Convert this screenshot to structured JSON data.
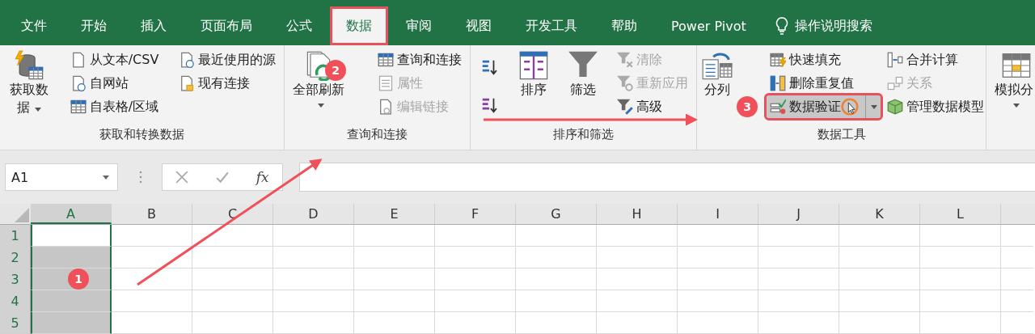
{
  "tabs": [
    {
      "label": "文件",
      "selected": false,
      "highlighted": false
    },
    {
      "label": "开始",
      "selected": false,
      "highlighted": false
    },
    {
      "label": "插入",
      "selected": false,
      "highlighted": false
    },
    {
      "label": "页面布局",
      "selected": false,
      "highlighted": false
    },
    {
      "label": "公式",
      "selected": false,
      "highlighted": false
    },
    {
      "label": "数据",
      "selected": true,
      "highlighted": true
    },
    {
      "label": "审阅",
      "selected": false,
      "highlighted": false
    },
    {
      "label": "视图",
      "selected": false,
      "highlighted": false
    },
    {
      "label": "开发工具",
      "selected": false,
      "highlighted": false
    },
    {
      "label": "帮助",
      "selected": false,
      "highlighted": false
    },
    {
      "label": "Power Pivot",
      "selected": false,
      "highlighted": false
    }
  ],
  "search": {
    "label": "操作说明搜索"
  },
  "ribbon": {
    "groups": [
      {
        "title": "获取和转换数据",
        "columns": [
          [
            {
              "kind": "large",
              "label": "获取数据",
              "dropdown": true,
              "disabled": false,
              "highlighted": false,
              "hovered": false
            }
          ],
          [
            {
              "kind": "small",
              "label": "从文本/CSV",
              "disabled": false,
              "highlighted": false,
              "hovered": false
            },
            {
              "kind": "small",
              "label": "自网站",
              "disabled": false,
              "highlighted": false,
              "hovered": false
            },
            {
              "kind": "small",
              "label": "自表格/区域",
              "disabled": false,
              "highlighted": false,
              "hovered": false
            }
          ],
          [
            {
              "kind": "small",
              "label": "最近使用的源",
              "disabled": false,
              "highlighted": false,
              "hovered": false
            },
            {
              "kind": "small",
              "label": "现有连接",
              "disabled": false,
              "highlighted": false,
              "hovered": false
            }
          ]
        ]
      },
      {
        "title": "查询和连接",
        "columns": [
          [
            {
              "kind": "large",
              "label": "全部刷新",
              "dropdown": true,
              "disabled": false,
              "highlighted": false,
              "hovered": false,
              "step": "2"
            }
          ],
          [
            {
              "kind": "small",
              "label": "查询和连接",
              "disabled": false,
              "highlighted": false,
              "hovered": false
            },
            {
              "kind": "small",
              "label": "属性",
              "disabled": true,
              "highlighted": false,
              "hovered": false
            },
            {
              "kind": "small",
              "label": "编辑链接",
              "disabled": true,
              "highlighted": false,
              "hovered": false
            }
          ]
        ]
      },
      {
        "title": "排序和筛选",
        "columns": [
          [
            {
              "kind": "icon",
              "disabled": false
            },
            {
              "kind": "icon",
              "disabled": false
            }
          ],
          [
            {
              "kind": "large",
              "label": "排序",
              "disabled": false,
              "highlighted": false,
              "hovered": false
            }
          ],
          [
            {
              "kind": "large",
              "label": "筛选",
              "disabled": false,
              "highlighted": false,
              "hovered": false
            }
          ],
          [
            {
              "kind": "small",
              "label": "清除",
              "disabled": true,
              "highlighted": false,
              "hovered": false
            },
            {
              "kind": "small",
              "label": "重新应用",
              "disabled": true,
              "highlighted": false,
              "hovered": false
            },
            {
              "kind": "small",
              "label": "高级",
              "disabled": false,
              "highlighted": false,
              "hovered": false
            }
          ]
        ]
      },
      {
        "title": "数据工具",
        "columns": [
          [
            {
              "kind": "large",
              "label": "分列",
              "disabled": false,
              "highlighted": false,
              "hovered": false
            }
          ],
          [
            {
              "kind": "small",
              "label": "快速填充",
              "disabled": false,
              "highlighted": false,
              "hovered": false
            },
            {
              "kind": "small",
              "label": "删除重复值",
              "disabled": false,
              "highlighted": false,
              "hovered": false
            },
            {
              "kind": "small",
              "label": "数据验证",
              "dropdown": true,
              "disabled": false,
              "highlighted": true,
              "hovered": true,
              "step": "3"
            }
          ],
          [
            {
              "kind": "small",
              "label": "合并计算",
              "disabled": false,
              "highlighted": false,
              "hovered": false
            },
            {
              "kind": "small",
              "label": "关系",
              "disabled": true,
              "highlighted": false,
              "hovered": false
            },
            {
              "kind": "small",
              "label": "管理数据模型",
              "disabled": false,
              "highlighted": false,
              "hovered": false
            }
          ]
        ]
      },
      {
        "columns": [
          [
            {
              "kind": "large",
              "label": "模拟分",
              "dropdown": true,
              "disabled": false,
              "highlighted": false,
              "hovered": false
            }
          ]
        ]
      }
    ]
  },
  "name_box": {
    "value": "A1"
  },
  "formula_bar": {
    "function_label": "fx"
  },
  "grid": {
    "columns": [
      {
        "label": "A",
        "selected": true
      },
      {
        "label": "B",
        "selected": false
      },
      {
        "label": "C",
        "selected": false
      },
      {
        "label": "D",
        "selected": false
      },
      {
        "label": "E",
        "selected": false
      },
      {
        "label": "F",
        "selected": false
      },
      {
        "label": "G",
        "selected": false
      },
      {
        "label": "H",
        "selected": false
      },
      {
        "label": "I",
        "selected": false
      },
      {
        "label": "J",
        "selected": false
      },
      {
        "label": "K",
        "selected": false
      },
      {
        "label": "L",
        "selected": false
      }
    ],
    "rows": [
      {
        "label": "1",
        "selected": true,
        "active": true
      },
      {
        "label": "2",
        "selected": true,
        "active": false
      },
      {
        "label": "3",
        "selected": true,
        "active": false,
        "step": "1"
      },
      {
        "label": "4",
        "selected": true,
        "active": false
      },
      {
        "label": "5",
        "selected": true,
        "active": false
      }
    ]
  }
}
